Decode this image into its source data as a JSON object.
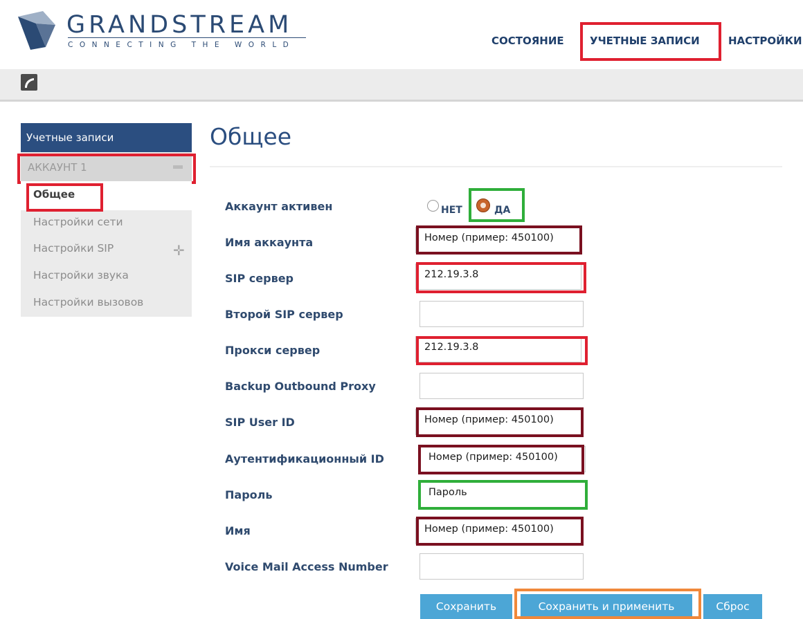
{
  "header": {
    "brand": "GRANDSTREAM",
    "tagline": "CONNECTING THE WORLD",
    "nav": {
      "status": "СОСТОЯНИЕ",
      "accounts": "УЧЕТНЫЕ ЗАПИСИ",
      "settings": "НАСТРОЙКИ"
    },
    "active_nav": "accounts"
  },
  "toolbar": {
    "icon": "phone-icon"
  },
  "sidebar": {
    "title": "Учетные записи",
    "account": "АККАУНТ 1",
    "items": [
      {
        "label": "Общее",
        "active": true
      },
      {
        "label": "Настройки сети"
      },
      {
        "label": "Настройки SIP",
        "expandable": true
      },
      {
        "label": "Настройки звука"
      },
      {
        "label": "Настройки вызовов"
      }
    ]
  },
  "main": {
    "title": "Общее",
    "account_active": {
      "label": "Аккаунт активен",
      "no_label": "НЕТ",
      "yes_label": "ДА",
      "selected": "ДА"
    },
    "fields": [
      {
        "label": "Имя аккаунта",
        "value": "Номер (пример: 450100)"
      },
      {
        "label": "SIP сервер",
        "value": "212.19.3.8"
      },
      {
        "label": "Второй SIP сервер",
        "value": ""
      },
      {
        "label": "Прокси сервер",
        "value": "212.19.3.8"
      },
      {
        "label": "Backup Outbound Proxy",
        "value": ""
      },
      {
        "label": "SIP User ID",
        "value": "Номер (пример: 450100)"
      },
      {
        "label": "Аутентификационный ID",
        "value": "Номер (пример: 450100)"
      },
      {
        "label": "Пароль",
        "value": "Пароль"
      },
      {
        "label": "Имя",
        "value": "Номер (пример: 450100)"
      },
      {
        "label": "Voice Mail Access Number",
        "value": ""
      }
    ],
    "buttons": {
      "save": "Сохранить",
      "save_apply": "Сохранить и применить",
      "reset": "Сброс"
    }
  },
  "colors": {
    "brand": "#2b4a74",
    "sidebar_header": "#2b4e80",
    "button": "#4ca6d6",
    "radio_selected": "#c8642c",
    "highlight_red": "#df2030",
    "highlight_green": "#2fae3a",
    "highlight_maroon": "#7a1020",
    "highlight_orange": "#f0883a"
  }
}
